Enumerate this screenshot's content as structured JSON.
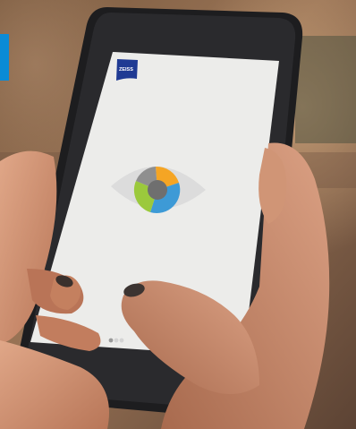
{
  "brand": {
    "logo_text": "ZEISS",
    "logo_color": "#1f3a93"
  },
  "screen": {
    "background": "#ececea",
    "carousel": {
      "dot_count": 3,
      "active_index": 0
    }
  },
  "eye_icon": {
    "sclera_color": "#dcdcdc",
    "pupil_color": "#6f6f6f",
    "segment_colors": [
      "#f5a524",
      "#3d9ad6",
      "#9bc93c",
      "#8f8f8f"
    ]
  },
  "side_tab": {
    "color": "#0a8bd6"
  }
}
